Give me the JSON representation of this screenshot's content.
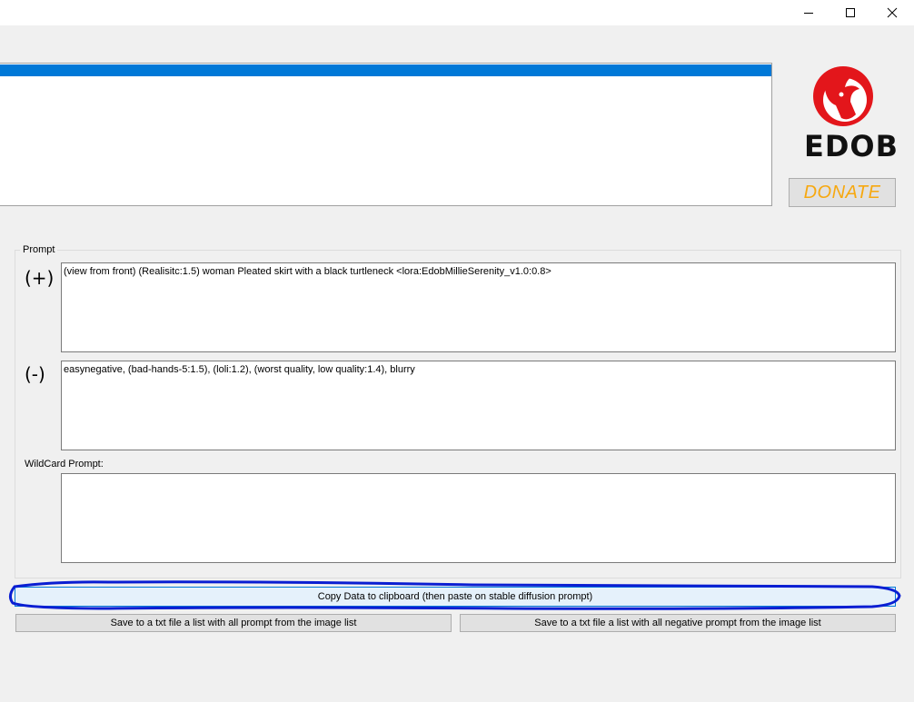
{
  "window": {
    "controls": {
      "minimize_icon": "minimize-icon",
      "maximize_icon": "maximize-icon",
      "close_icon": "close-icon"
    }
  },
  "logo": {
    "text": "EDOB",
    "icon": "goat-head-icon",
    "color": "#e3161b"
  },
  "donate_label": "DONATE",
  "prompt_group": {
    "title": "Prompt",
    "positive_sign": "(+)",
    "positive_text": "(view from front) (Realisitc:1.5) woman Pleated skirt with a black turtleneck <lora:EdobMillieSerenity_v1.0:0.8>",
    "negative_sign": "(-)",
    "negative_text": "easynegative, (bad-hands-5:1.5), (loli:1.2), (worst quality, low quality:1.4), blurry",
    "wildcard_label": "WildCard Prompt:",
    "wildcard_text": ""
  },
  "buttons": {
    "copy": "Copy Data to clipboard (then paste on stable diffusion prompt)",
    "save_positive": "Save to a txt file a list with all prompt from the image list",
    "save_negative": "Save to a txt file a list with all negative prompt from the image list"
  },
  "colors": {
    "selection": "#0078d7",
    "donate_text": "#f7a80f",
    "annotation": "#0a1ed2"
  }
}
